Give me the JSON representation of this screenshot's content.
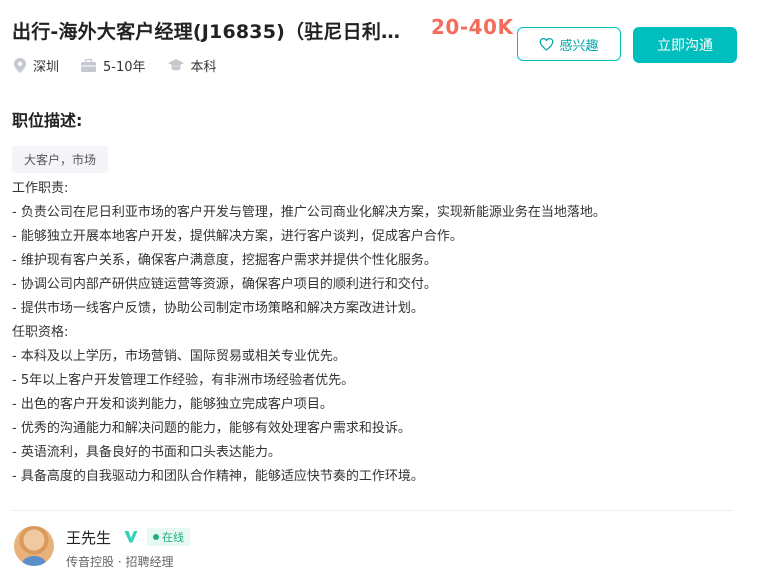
{
  "job": {
    "title": "出行-海外大客户经理(J16835)（驻尼日利…",
    "salary": "20-40K",
    "location": "深圳",
    "experience": "5-10年",
    "education": "本科"
  },
  "actions": {
    "interest_label": "感兴趣",
    "chat_label": "立即沟通"
  },
  "description": {
    "section_title": "职位描述:",
    "tags": [
      "大客户，市场"
    ],
    "lines": [
      "工作职责:",
      "- 负责公司在尼日利亚市场的客户开发与管理，推广公司商业化解决方案，实现新能源业务在当地落地。",
      "- 能够独立开展本地客户开发，提供解决方案，进行客户谈判，促成客户合作。",
      "- 维护现有客户关系，确保客户满意度，挖掘客户需求并提供个性化服务。",
      "- 协调公司内部产研供应链运营等资源，确保客户项目的顺利进行和交付。",
      "- 提供市场一线客户反馈，协助公司制定市场策略和解决方案改进计划。",
      "任职资格:",
      "- 本科及以上学历，市场营销、国际贸易或相关专业优先。",
      "- 5年以上客户开发管理工作经验，有非洲市场经验者优先。",
      "- 出色的客户开发和谈判能力，能够独立完成客户项目。",
      "- 优秀的沟通能力和解决问题的能力，能够有效处理客户需求和投诉。",
      "- 英语流利，具备良好的书面和口头表达能力。",
      "- 具备高度的自我驱动力和团队合作精神，能够适应快节奏的工作环境。"
    ]
  },
  "recruiter": {
    "name": "王先生",
    "status": "在线",
    "company_role": "传音控股 · 招聘经理"
  },
  "colors": {
    "accent": "#00bebd",
    "salary": "#f26d5b",
    "online": "#1fb17b"
  }
}
